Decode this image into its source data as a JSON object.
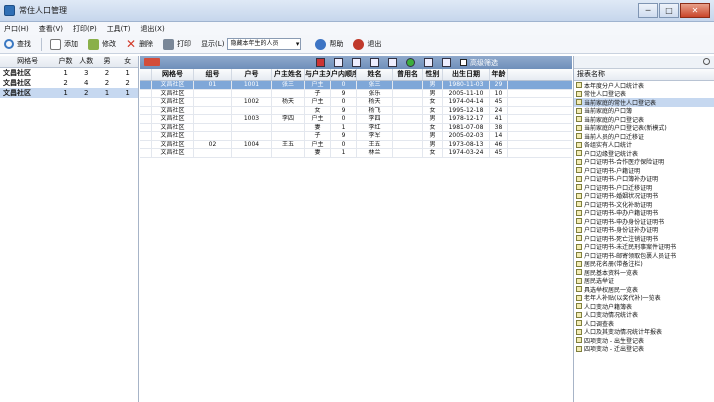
{
  "window": {
    "title": "常住人口管理",
    "min_label": "─",
    "max_label": "□",
    "close_label": "✕"
  },
  "menu": [
    "户口(H)",
    "查看(V)",
    "打印(P)",
    "工具(T)",
    "退出(X)"
  ],
  "toolbar": {
    "find": "查找",
    "add": "添加",
    "edit": "修改",
    "delete": "删除",
    "print": "打印",
    "display_label": "显示(L)",
    "display_value": "隐藏本年生的人员",
    "help": "帮助",
    "exit": "退出",
    "colors": {
      "find": "#3a78c2",
      "add": "#e8e8e8",
      "edit": "#8ab04a",
      "delete": "#d23b2a",
      "print": "#7a8798",
      "help": "#3d74c4",
      "exit": "#c0392b"
    }
  },
  "left_panel": {
    "headers": [
      "网格号",
      "户数",
      "人数",
      "男",
      "女"
    ],
    "rows": [
      {
        "name": "文昌社区",
        "households": "1",
        "people": "3",
        "male": "2",
        "female": "1"
      },
      {
        "name": "文昌社区",
        "households": "2",
        "people": "4",
        "male": "2",
        "female": "2"
      },
      {
        "name": "文昌社区",
        "households": "1",
        "people": "2",
        "male": "1",
        "female": "1"
      }
    ]
  },
  "grid_toolbar": {
    "filter_label": "高级筛选"
  },
  "grid": {
    "headers": [
      "网格号",
      "组号",
      "户号",
      "户主姓名",
      "与户主关系",
      "户内顺序",
      "姓名",
      "曾用名",
      "性别",
      "出生日期",
      "年龄"
    ],
    "rows": [
      [
        "文昌社区",
        "01",
        "1001",
        "张三",
        "户主",
        "0",
        "张三",
        "",
        "男",
        "1980-11-03",
        "29"
      ],
      [
        "文昌社区",
        "",
        "",
        "",
        "子",
        "9",
        "张乐",
        "",
        "男",
        "2005-11-10",
        "10"
      ],
      [
        "文昌社区",
        "",
        "1002",
        "杨天",
        "户主",
        "0",
        "杨天",
        "",
        "女",
        "1974-04-14",
        "45"
      ],
      [
        "文昌社区",
        "",
        "",
        "",
        "女",
        "9",
        "杨飞",
        "",
        "女",
        "1995-12-18",
        "24"
      ],
      [
        "文昌社区",
        "",
        "1003",
        "李四",
        "户主",
        "0",
        "李四",
        "",
        "男",
        "1978-12-17",
        "41"
      ],
      [
        "文昌社区",
        "",
        "",
        "",
        "妻",
        "1",
        "李红",
        "",
        "女",
        "1981-07-08",
        "38"
      ],
      [
        "文昌社区",
        "",
        "",
        "",
        "子",
        "9",
        "李军",
        "",
        "男",
        "2005-02-03",
        "14"
      ],
      [
        "文昌社区",
        "02",
        "1004",
        "王五",
        "户主",
        "0",
        "王五",
        "",
        "男",
        "1973-08-13",
        "46"
      ],
      [
        "文昌社区",
        "",
        "",
        "",
        "妻",
        "1",
        "林兰",
        "",
        "女",
        "1974-03-24",
        "45"
      ]
    ]
  },
  "report_panel": {
    "header": "报表名称",
    "items": [
      "本年度分户人口统计表",
      "常住人口登记表",
      "当前家庭的常住人口登记表",
      "当前家庭的户口簿",
      "当前家庭的户口登记表",
      "当前家庭的户口登记表(新模式)",
      "当前人员的户口迁移证",
      "各组实有人口统计",
      "户口边缘登记统计表",
      "户口证明书-合作医疗保险证明",
      "户口证明书-户籍证明",
      "户口证明书-户口簿补办证明",
      "户口证明书-户口迁移证明",
      "户口证明书-婚姻状况证明书",
      "户口证明书-文化补助证明",
      "户口证明书-申办户籍证明书",
      "户口证明书-申办身份证证明书",
      "户口证明书-身份证补办证明",
      "户口证明书-死亡注销证明书",
      "户口证明书-未迁民刑事案件证明书",
      "户口证明书-邮寄领取包裹人员证书",
      "居民花名册(带备注栏)",
      "居民基本资料一览表",
      "居民选举证",
      "具选举权居民一览表",
      "老年人补贴(以奖代补)一览表",
      "人口变动户籍簿表",
      "人口变动情况统计表",
      "人口调查表",
      "人口及其变动情况统计年报表",
      "四项变动 - 出生登记表",
      "四项变动 - 迁出登记表"
    ]
  }
}
